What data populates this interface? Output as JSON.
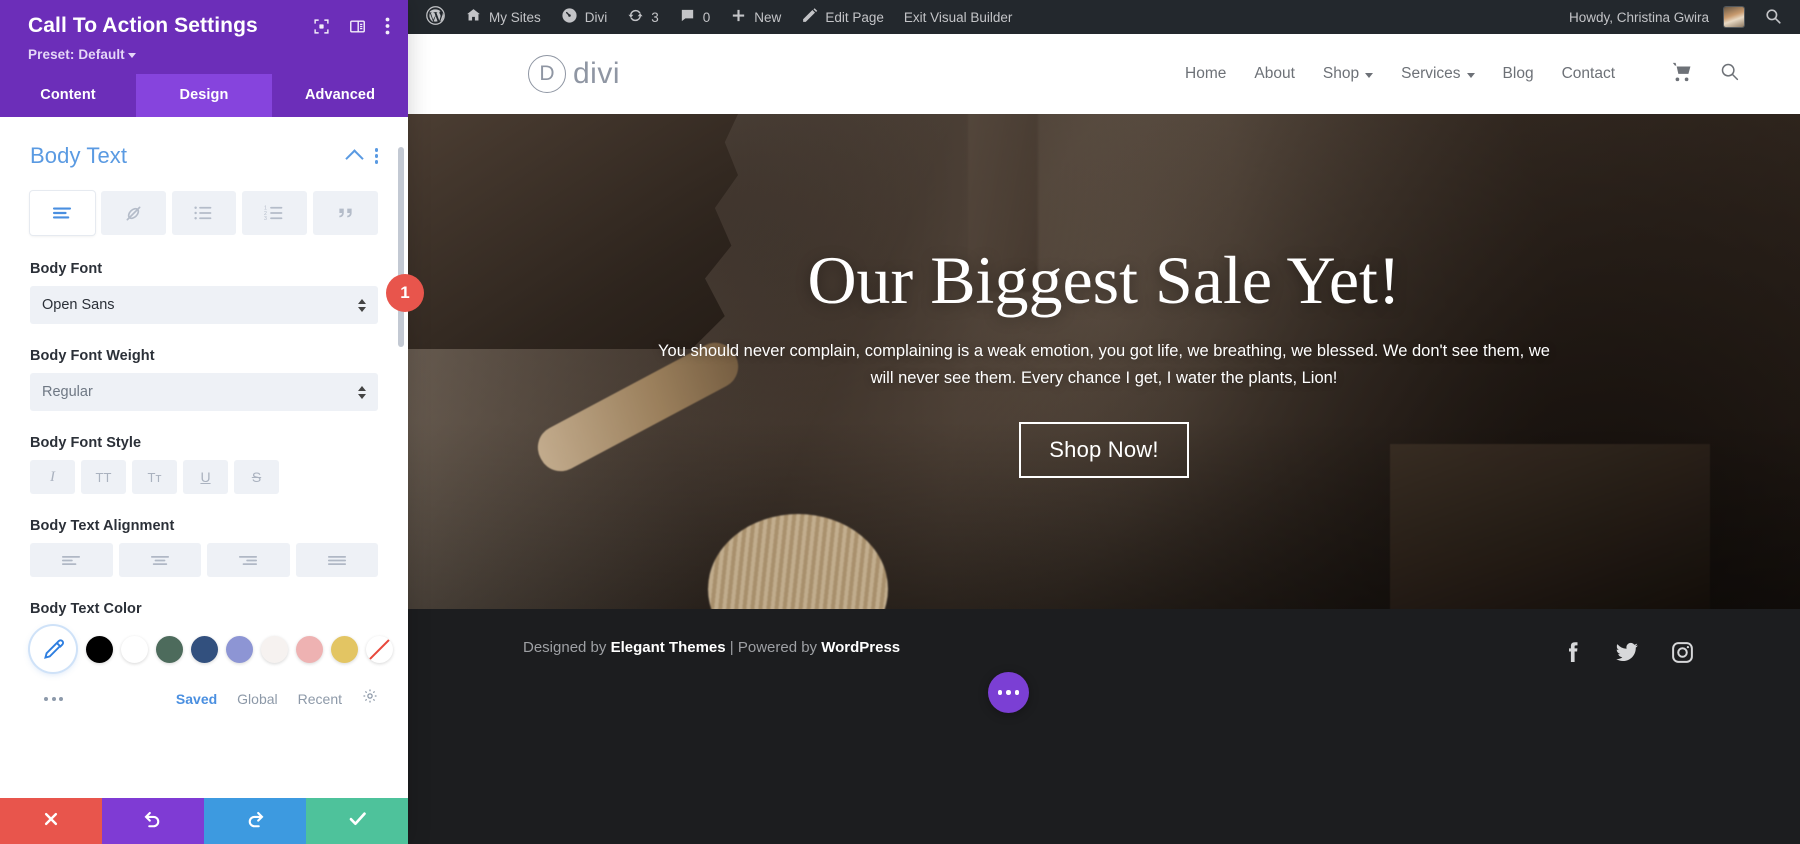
{
  "settings_panel": {
    "title": "Call To Action Settings",
    "preset_label": "Preset: Default",
    "header_icons": [
      "focus-target-icon",
      "layout-panel-icon",
      "kebab-menu-icon"
    ],
    "tabs": [
      {
        "label": "Content",
        "active": false
      },
      {
        "label": "Design",
        "active": true
      },
      {
        "label": "Advanced",
        "active": false
      }
    ],
    "section": {
      "title": "Body Text",
      "toolbar": [
        {
          "name": "text-align-icon",
          "active": true
        },
        {
          "name": "no-link-icon",
          "active": false
        },
        {
          "name": "bulleted-list-icon",
          "active": false
        },
        {
          "name": "numbered-list-icon",
          "active": false
        },
        {
          "name": "blockquote-icon",
          "active": false
        }
      ],
      "fields": [
        {
          "label": "Body Font",
          "value": "Open Sans",
          "type": "select",
          "muted": false
        },
        {
          "label": "Body Font Weight",
          "value": "Regular",
          "type": "select",
          "muted": true
        }
      ],
      "font_style": {
        "label": "Body Font Style",
        "options": [
          {
            "name": "italic-icon",
            "glyph": "I"
          },
          {
            "name": "uppercase-icon",
            "glyph": "TT"
          },
          {
            "name": "smallcaps-icon",
            "glyph": "Tᴛ"
          },
          {
            "name": "underline-icon",
            "glyph": "U"
          },
          {
            "name": "strikethrough-icon",
            "glyph": "S"
          }
        ]
      },
      "text_alignment": {
        "label": "Body Text Alignment",
        "options": [
          "align-left-icon",
          "align-center-icon",
          "align-right-icon",
          "align-justify-icon"
        ]
      },
      "text_color": {
        "label": "Body Text Color",
        "picker_icon": "eyedropper-icon",
        "swatches": [
          "#000000",
          "#ffffff",
          "#4d6b5c",
          "#32507e",
          "#8d95d4",
          "#f6f2f0",
          "#eeb2b2",
          "#e3c563",
          "none"
        ],
        "tabs": [
          {
            "label": "Saved",
            "active": true
          },
          {
            "label": "Global",
            "active": false
          },
          {
            "label": "Recent",
            "active": false
          }
        ],
        "settings_icon": "gear-icon",
        "more_icon": "more-dots-icon"
      }
    },
    "footer_buttons": [
      {
        "name": "cancel-button",
        "icon": "close-icon",
        "color": "#e8554c"
      },
      {
        "name": "undo-button",
        "icon": "undo-icon",
        "color": "#7f3bd4"
      },
      {
        "name": "redo-button",
        "icon": "redo-icon",
        "color": "#3d9ae0"
      },
      {
        "name": "save-button",
        "icon": "check-icon",
        "color": "#4ec29b"
      }
    ]
  },
  "step_marker": {
    "number": "1"
  },
  "wp_adminbar": {
    "items": [
      {
        "label": "",
        "icon": "wordpress-logo-icon"
      },
      {
        "label": "My Sites",
        "icon": "sites-icon"
      },
      {
        "label": "Divi",
        "icon": "dashboard-icon"
      },
      {
        "label": "3",
        "icon": "updates-icon"
      },
      {
        "label": "0",
        "icon": "comments-icon"
      },
      {
        "label": "New",
        "icon": "plus-icon"
      },
      {
        "label": "Edit Page",
        "icon": "pencil-icon"
      },
      {
        "label": "Exit Visual Builder",
        "icon": ""
      }
    ],
    "howdy": "Howdy, Christina Gwira",
    "search_icon": "search-icon"
  },
  "site_header": {
    "logo_letter": "D",
    "logo_text": "divi",
    "nav": [
      {
        "label": "Home",
        "has_dropdown": false
      },
      {
        "label": "About",
        "has_dropdown": false
      },
      {
        "label": "Shop",
        "has_dropdown": true
      },
      {
        "label": "Services",
        "has_dropdown": true
      },
      {
        "label": "Blog",
        "has_dropdown": false
      },
      {
        "label": "Contact",
        "has_dropdown": false
      }
    ],
    "icons": [
      "cart-icon",
      "search-icon"
    ]
  },
  "hero": {
    "title": "Our Biggest Sale Yet!",
    "subtitle": "You should never complain, complaining is a weak emotion, you got life, we breathing, we blessed. We don't see them, we will never see them. Every chance I get, I water the plants, Lion!",
    "button_label": "Shop Now!"
  },
  "site_footer": {
    "credit_prefix": "Designed by ",
    "credit_brand1": "Elegant Themes",
    "credit_middle": " | Powered by ",
    "credit_brand2": "WordPress",
    "social": [
      "facebook-icon",
      "twitter-icon",
      "instagram-icon"
    ]
  },
  "divi_fab": {
    "name": "divi-menu-fab"
  }
}
